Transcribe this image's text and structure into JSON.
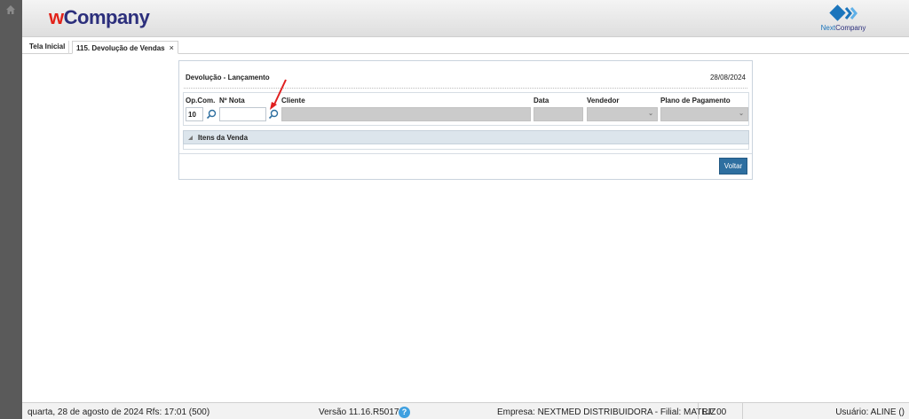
{
  "header": {
    "logo_prefix": "w",
    "logo_main": "Company",
    "brand_next": "Next",
    "brand_company": "Company"
  },
  "tabs": [
    {
      "label": "Tela Inicial"
    },
    {
      "label": "115. Devolução de Vendas",
      "close": "×"
    }
  ],
  "panel": {
    "title": "Devolução - Lançamento",
    "date": "28/08/2024"
  },
  "fields": {
    "opcom_label": "Op.Com.",
    "opcom_value": "10",
    "nota_label": "Nº Nota",
    "nota_value": "",
    "cliente_label": "Cliente",
    "data_label": "Data",
    "vendedor_label": "Vendedor",
    "plano_label": "Plano de Pagamento",
    "select_arrow": "⌄"
  },
  "items_section": {
    "label": "Itens da Venda"
  },
  "buttons": {
    "voltar": "Voltar"
  },
  "status": {
    "datetime": "quarta, 28 de agosto de 2024  Rfs: 17:01 (500)",
    "version": "Versão 11.16.R5017",
    "help": "?",
    "empresa": "Empresa: NEXTMED DISTRIBUIDORA - Filial: MATRIZ",
    "lj": "LJ: 00",
    "usuario": "Usuário: ALINE ()"
  },
  "colors": {
    "accent": "#2e6fa0",
    "logo_red": "#e2231a",
    "logo_navy": "#2c2f7c",
    "annotation_red": "#e02020"
  },
  "icons": [
    "home-icon",
    "search-icon",
    "chevron-down-icon",
    "collapse-icon",
    "help-icon",
    "nextcompany-logo"
  ]
}
